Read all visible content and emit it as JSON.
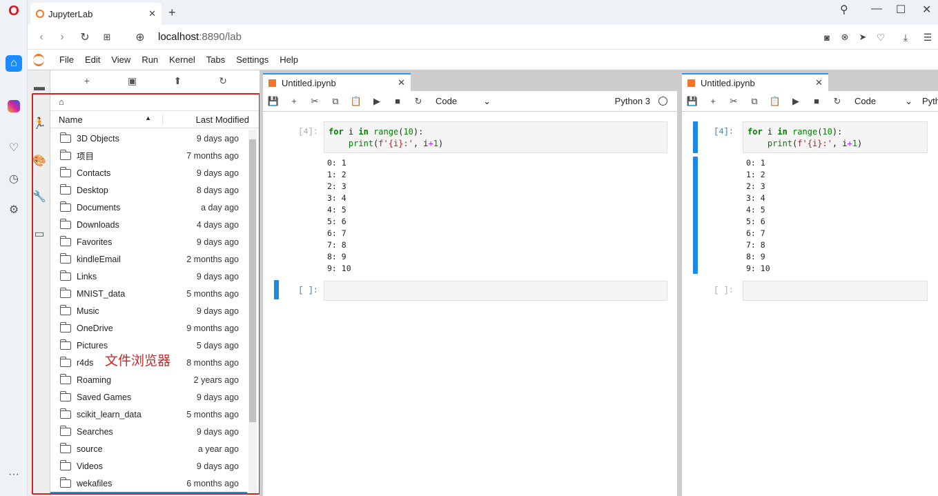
{
  "browser": {
    "tab_title": "JupyterLab",
    "url_host": "localhost",
    "url_rest": ":8890/lab"
  },
  "menu": [
    "File",
    "Edit",
    "View",
    "Run",
    "Kernel",
    "Tabs",
    "Settings",
    "Help"
  ],
  "filebrowser": {
    "col_name": "Name",
    "col_modified": "Last Modified",
    "items": [
      {
        "name": "3D Objects",
        "modified": "9 days ago"
      },
      {
        "name": "项目",
        "modified": "7 months ago"
      },
      {
        "name": "Contacts",
        "modified": "9 days ago"
      },
      {
        "name": "Desktop",
        "modified": "8 days ago"
      },
      {
        "name": "Documents",
        "modified": "a day ago"
      },
      {
        "name": "Downloads",
        "modified": "4 days ago"
      },
      {
        "name": "Favorites",
        "modified": "9 days ago"
      },
      {
        "name": "kindleEmail",
        "modified": "2 months ago"
      },
      {
        "name": "Links",
        "modified": "9 days ago"
      },
      {
        "name": "MNIST_data",
        "modified": "5 months ago"
      },
      {
        "name": "Music",
        "modified": "9 days ago"
      },
      {
        "name": "OneDrive",
        "modified": "9 months ago"
      },
      {
        "name": "Pictures",
        "modified": "5 days ago"
      },
      {
        "name": "r4ds",
        "modified": "8 months ago"
      },
      {
        "name": "Roaming",
        "modified": "2 years ago"
      },
      {
        "name": "Saved Games",
        "modified": "9 days ago"
      },
      {
        "name": "scikit_learn_data",
        "modified": "5 months ago"
      },
      {
        "name": "Searches",
        "modified": "9 days ago"
      },
      {
        "name": "source",
        "modified": "a year ago"
      },
      {
        "name": "Videos",
        "modified": "9 days ago"
      },
      {
        "name": "wekafiles",
        "modified": "6 months ago"
      }
    ],
    "annotation": "文件浏览器"
  },
  "notebook_left": {
    "tab_title": "Untitled.ipynb",
    "cell_type": "Code",
    "kernel": "Python 3",
    "prompt_run": "[4]:",
    "prompt_empty": "[ ]:",
    "code_line1": "for i in range(10):",
    "code_line2": "    print(f'{i}:', i+1)",
    "output": "0: 1\n1: 2\n2: 3\n3: 4\n4: 5\n5: 6\n6: 7\n7: 8\n8: 9\n9: 10"
  },
  "notebook_right": {
    "tab_title": "Untitled.ipynb",
    "cell_type": "Code",
    "kernel": "Pytho",
    "prompt_run": "[4]:",
    "prompt_empty": "[ ]:",
    "output": "0: 1\n1: 2\n2: 3\n3: 4\n4: 5\n5: 6\n6: 7\n7: 8\n8: 9\n9: 10"
  }
}
